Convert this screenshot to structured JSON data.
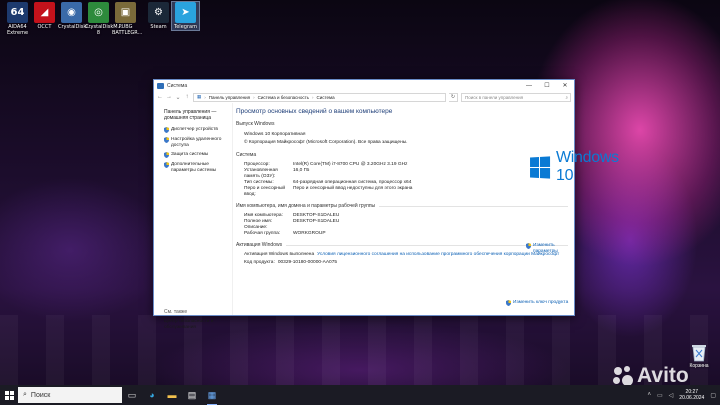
{
  "desktop": {
    "icons": [
      {
        "label": "AIDA64 Extreme",
        "glyph": "64",
        "color": "#1d3a6e",
        "icon": "aida64-icon"
      },
      {
        "label": "OCCT",
        "glyph": "◢",
        "color": "#c4121b",
        "icon": "occt-icon"
      },
      {
        "label": "CrystalDiskI...",
        "glyph": "◉",
        "color": "#3a6aa8",
        "icon": "crystaldiskinfo-icon"
      },
      {
        "label": "CrystalDiskM... 8",
        "glyph": "◎",
        "color": "#2d8a3c",
        "icon": "crystaldiskmark-icon"
      },
      {
        "label": "PUBG BATTLEGR...",
        "glyph": "▣",
        "color": "#7a6a3a",
        "icon": "pubg-icon"
      },
      {
        "label": "Steam",
        "glyph": "⚙",
        "color": "#1b2838",
        "icon": "steam-icon"
      },
      {
        "label": "Telegram",
        "glyph": "➤",
        "color": "#2aa3de",
        "icon": "telegram-icon"
      }
    ],
    "recycle_bin_label": "Корзина",
    "watermark_text": "Avito"
  },
  "window": {
    "title": "Система",
    "controls": {
      "minimize": "—",
      "maximize": "☐",
      "close": "✕"
    },
    "breadcrumb": [
      "Панель управления",
      "Система и безопасность",
      "Система"
    ],
    "search_placeholder": "Поиск в панели управления",
    "sidebar": {
      "home": "Панель управления — домашняя страница",
      "links": [
        "Диспетчер устройств",
        "Настройка удаленного доступа",
        "Защита системы",
        "Дополнительные параметры системы"
      ],
      "see_also_title": "См. также",
      "see_also_link": "Центр безопасности и обслуживания"
    },
    "page_title": "Просмотр основных сведений о вашем компьютере",
    "edition": {
      "heading": "Выпуск Windows",
      "name": "Windows 10 Корпоративная",
      "copyright": "© Корпорация Майкрософт (Microsoft Corporation). Все права защищены."
    },
    "logo_text": "Windows 10",
    "system": {
      "heading": "Система",
      "rows": [
        {
          "k": "Процессор:",
          "v": "Intel(R) Core(TM) i7-8700 CPU @ 3.20GHz   3.19 GHz"
        },
        {
          "k": "Установленная память (ОЗУ):",
          "v": "16,0 ГБ"
        },
        {
          "k": "Тип системы:",
          "v": "64-разрядная операционная система, процессор x64"
        },
        {
          "k": "Перо и сенсорный ввод:",
          "v": "Перо и сенсорный ввод недоступны для этого экрана"
        }
      ]
    },
    "computer": {
      "heading": "Имя компьютера, имя домена и параметры рабочей группы",
      "rows": [
        {
          "k": "Имя компьютера:",
          "v": "DESKTOP-S1DALEU"
        },
        {
          "k": "Полное имя:",
          "v": "DESKTOP-S1DALEU"
        },
        {
          "k": "Описание:",
          "v": ""
        },
        {
          "k": "Рабочая группа:",
          "v": "WORKGROUP"
        }
      ],
      "change_link": "Изменить параметры"
    },
    "activation": {
      "heading": "Активация Windows",
      "status": "Активация Windows выполнена",
      "license_link": "Условия лицензионного соглашения на использование программного обеспечения корпорации Майкрософт",
      "product_id_label": "Код продукта:",
      "product_id": "00329-10180-00000-AA075",
      "change_key_link": "Изменить ключ продукта"
    }
  },
  "taskbar": {
    "search_placeholder": "Поиск",
    "time": "20:27",
    "date": "20.06.2024"
  }
}
